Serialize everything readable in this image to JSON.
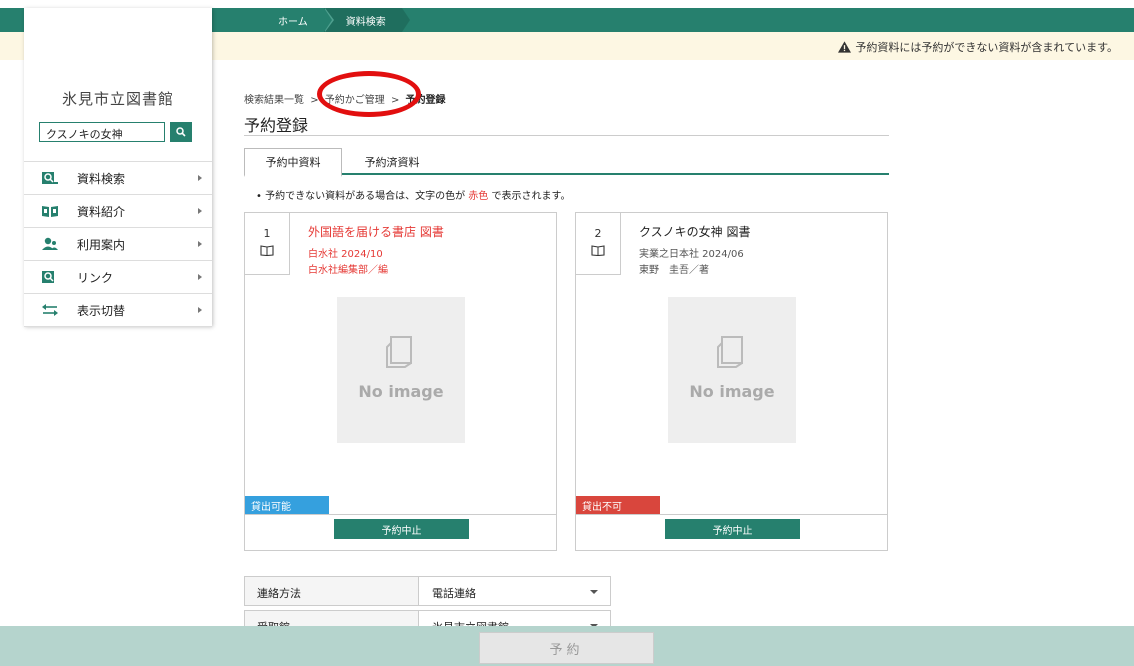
{
  "top_nav": {
    "breadcrumbs": [
      "ホーム",
      "資料検索"
    ]
  },
  "notice": {
    "text": "予約資料には予約ができない資料が含まれています。",
    "icon": "warning-icon"
  },
  "sidebar": {
    "library_name": "氷見市立図書館",
    "search": {
      "value": "クスノキの女神",
      "icon": "search-icon"
    },
    "menu": [
      {
        "label": "資料検索",
        "icon": "book-search-icon"
      },
      {
        "label": "資料紹介",
        "icon": "open-book-icon"
      },
      {
        "label": "利用案内",
        "icon": "users-icon"
      },
      {
        "label": "リンク",
        "icon": "link-icon"
      },
      {
        "label": "表示切替",
        "icon": "switch-arrows-icon"
      }
    ]
  },
  "main": {
    "breadcrumb": {
      "items": [
        "検索結果一覧",
        ">",
        "予約かご管理",
        ">",
        "予約登録"
      ]
    },
    "title": "予約登録",
    "tabs": [
      {
        "label": "予約中資料",
        "active": true
      },
      {
        "label": "予約済資料",
        "active": false
      }
    ],
    "hint": {
      "prefix": "•  予約できない資料がある場合は、文字の色が ",
      "red_word": "赤色",
      "suffix": " で表示されます。"
    },
    "cards": [
      {
        "number": "1",
        "title": "外国語を届ける書店 図書",
        "publisher": "白水社 2024/10",
        "author": "白水社編集部／編",
        "no_image": "No image",
        "status": "貸出可能",
        "status_color": "#35a0de",
        "cancel_label": "予約中止"
      },
      {
        "number": "2",
        "title": "クスノキの女神 図書",
        "publisher": "実業之日本社 2024/06",
        "author": "東野　圭吾／著",
        "no_image": "No image",
        "status": "貸出不可",
        "status_color": "#d9463d",
        "cancel_label": "予約中止"
      }
    ],
    "form": [
      {
        "label": "連絡方法",
        "value": "電話連絡"
      },
      {
        "label": "受取館",
        "value": "氷見市立図書館"
      }
    ]
  },
  "footer": {
    "reserve_label": "予約"
  },
  "colors": {
    "brand": "#26806e",
    "notice_bg": "#fdf7e3",
    "footer_bg": "#b5d4cd",
    "highlight_ring": "#e20f0f"
  }
}
